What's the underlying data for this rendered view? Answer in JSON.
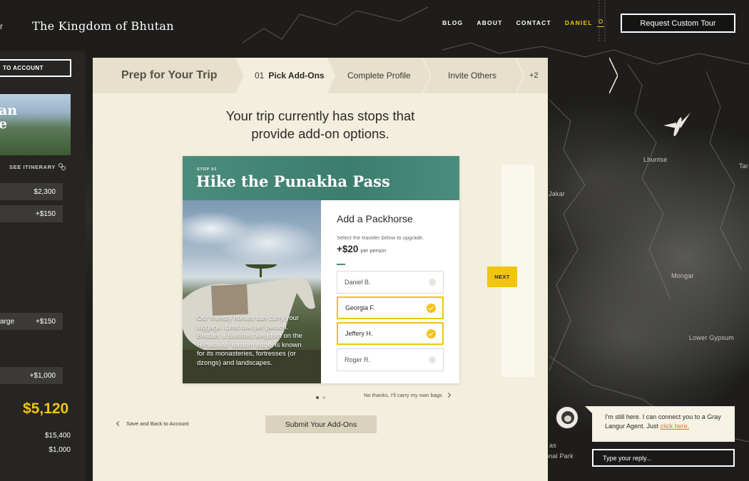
{
  "site": {
    "brand": "The Kingdom of Bhutan",
    "brand_edge": "r"
  },
  "nav": {
    "blog": "BLOG",
    "about": "ABOUT",
    "contact": "CONTACT",
    "user": "DANIEL"
  },
  "request_button": "Request Custom Tour",
  "sidebar": {
    "back_label": "TO ACCOUNT",
    "photo_title_1": "an",
    "photo_title_2": "e",
    "see_itinerary": "SEE ITINERARY",
    "rows": [
      {
        "left": "",
        "value": "$2,300"
      },
      {
        "left": "",
        "value": "+$150"
      },
      {
        "left": "arge",
        "value": "+$150"
      },
      {
        "left": "",
        "value": "+$1,000"
      }
    ],
    "total": "$5,120",
    "sub_1": "$15,400",
    "sub_2": "$1,000"
  },
  "steps": {
    "prep": "Prep for Your Trip",
    "active_num": "01",
    "active_label": "Pick Add-Ons",
    "step2": "Complete Profile",
    "step3": "Invite Others",
    "more": "+2"
  },
  "headline_1": "Your trip currently has stops that",
  "headline_2": "provide add-on options.",
  "card": {
    "stop": "STOP 02",
    "title": "Hike the Punakha Pass",
    "photo_text": "Our friendly horses can carry your luggage. Limit one per person. Bhutan, a Buddhist kingdom on the Himalayas' eastern edge, is known for its monasteries, fortresses (or dzongs) and landscapes.",
    "addon_title": "Add a Packhorse",
    "addon_hint": "Select the traveler below to upgrade.",
    "price": "+$20",
    "price_unit": "per person",
    "travelers": [
      {
        "name": "Daniel B.",
        "selected": false
      },
      {
        "name": "Georgia F.",
        "selected": true
      },
      {
        "name": "Jeffery H.",
        "selected": true
      },
      {
        "name": "Roger R.",
        "selected": false
      }
    ]
  },
  "next_label": "NEXT",
  "no_thanks": "No thanks, I'll carry my own bags",
  "back_to_account": "Save and Back to Account",
  "submit": "Submit Your Add-Ons",
  "map_labels": [
    "Lhuntse",
    "Jakar",
    "Mongar",
    "Lower Gypsum",
    "Tar",
    "onal Park",
    "as"
  ],
  "chat": {
    "message": "I'm still here. I can connect you to a Gray Langur Agent. Just",
    "link": "click here.",
    "placeholder": "Type your reply..."
  },
  "colors": {
    "accent": "#f1c40f",
    "teal": "#3c7d6e",
    "panel": "#f3eedd",
    "link": "#e07a2a"
  }
}
